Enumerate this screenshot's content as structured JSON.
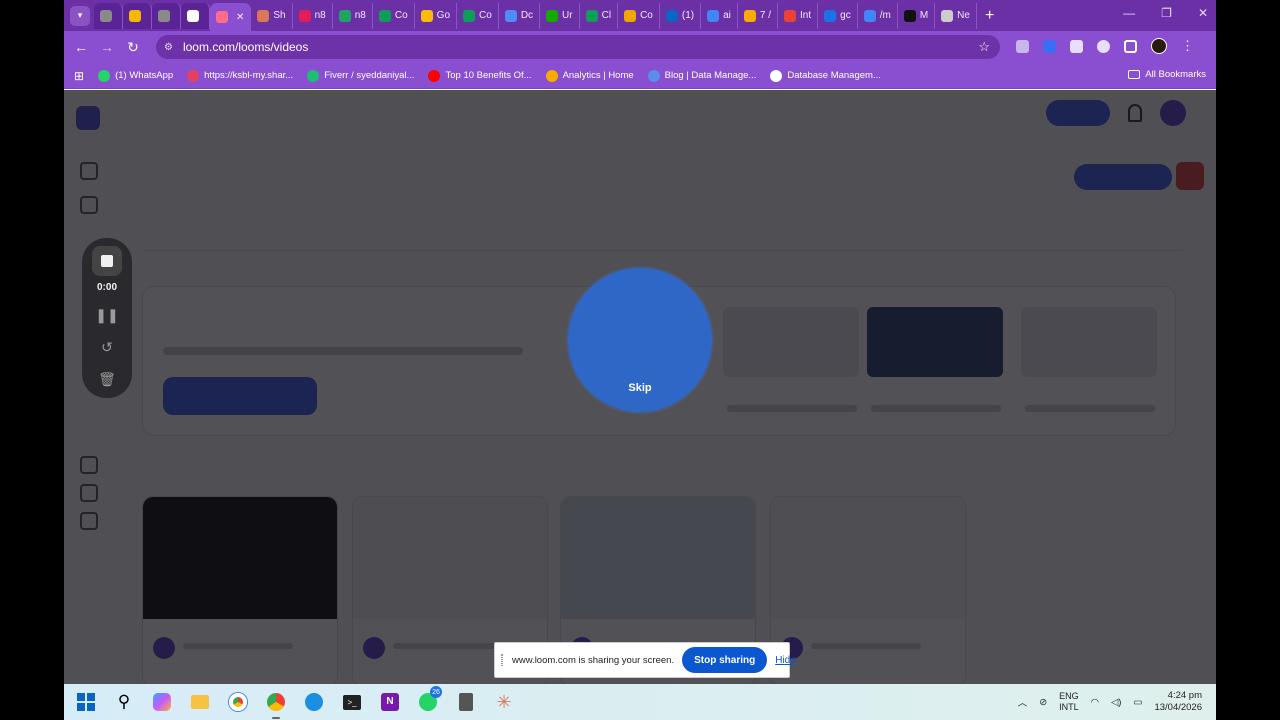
{
  "browser": {
    "tabs": [
      {
        "label": "",
        "icon": "globe-icon",
        "color": "#8a8a8a"
      },
      {
        "label": "",
        "icon": "warning-icon",
        "color": "#f5b800"
      },
      {
        "label": "",
        "icon": "globe-icon",
        "color": "#8a8a8a"
      },
      {
        "label": "",
        "icon": "play-icon",
        "color": "#ffffff"
      },
      {
        "label": "",
        "icon": "loom-icon",
        "color": "#ff6b8a",
        "active": true
      },
      {
        "label": "Sh",
        "icon": "claude-icon",
        "color": "#d97757"
      },
      {
        "label": "n8",
        "icon": "slack-icon",
        "color": "#e01e5a"
      },
      {
        "label": "n8",
        "icon": "drive-icon",
        "color": "#1fa463"
      },
      {
        "label": "Co",
        "icon": "sheets-icon",
        "color": "#0f9d58"
      },
      {
        "label": "Go",
        "icon": "ads-icon",
        "color": "#fbbc04"
      },
      {
        "label": "Co",
        "icon": "sheets-icon",
        "color": "#0f9d58"
      },
      {
        "label": "Dc",
        "icon": "gemini-icon",
        "color": "#4f8cf7"
      },
      {
        "label": "Ur",
        "icon": "upwork-icon",
        "color": "#14a800"
      },
      {
        "label": "Cl",
        "icon": "sheets-icon",
        "color": "#0f9d58"
      },
      {
        "label": "Co",
        "icon": "chrome-icon",
        "color": "#f2a600"
      },
      {
        "label": "(1)",
        "icon": "linkedin-icon",
        "color": "#0a66c2"
      },
      {
        "label": "ai",
        "icon": "google-icon",
        "color": "#4285f4"
      },
      {
        "label": "7 /",
        "icon": "notebook-icon",
        "color": "#f9ab00"
      },
      {
        "label": "Int",
        "icon": "gmail-icon",
        "color": "#ea4335"
      },
      {
        "label": "gc",
        "icon": "gear-icon",
        "color": "#1a73e8"
      },
      {
        "label": "/m",
        "icon": "google-icon",
        "color": "#4285f4"
      },
      {
        "label": "M",
        "icon": "openai-icon",
        "color": "#111111"
      },
      {
        "label": "Ne",
        "icon": "chrome-icon",
        "color": "#cccccc"
      }
    ],
    "url": "loom.com/looms/videos",
    "bookmarks": [
      {
        "label": "(1) WhatsApp",
        "icon": "whatsapp-icon",
        "color": "#25d366"
      },
      {
        "label": "https://ksbl-my.shar...",
        "icon": "sharepoint-icon",
        "color": "#e4405f"
      },
      {
        "label": "Fiverr / syeddaniyal...",
        "icon": "fiverr-icon",
        "color": "#1dbf73"
      },
      {
        "label": "Top 10 Benefits Of...",
        "icon": "youtube-icon",
        "color": "#ff0000"
      },
      {
        "label": "Analytics | Home",
        "icon": "analytics-icon",
        "color": "#f9ab00"
      },
      {
        "label": "Blog | Data Manage...",
        "icon": "blog-icon",
        "color": "#5b8def"
      },
      {
        "label": "Database Managem...",
        "icon": "globe-icon",
        "color": "#ffffff"
      }
    ],
    "all_bookmarks": "All Bookmarks"
  },
  "loom": {
    "recorder": {
      "timer": "0:00"
    },
    "countdown": {
      "skip_label": "Skip"
    }
  },
  "sharebar": {
    "message": "www.loom.com is sharing your screen.",
    "stop_label": "Stop sharing",
    "hide_label": "Hide"
  },
  "taskbar": {
    "edge_badge": "",
    "whatsapp_badge": "26",
    "lang": [
      "ENG",
      "INTL"
    ],
    "time": "4:24 pm",
    "date": "13/04/2026"
  }
}
